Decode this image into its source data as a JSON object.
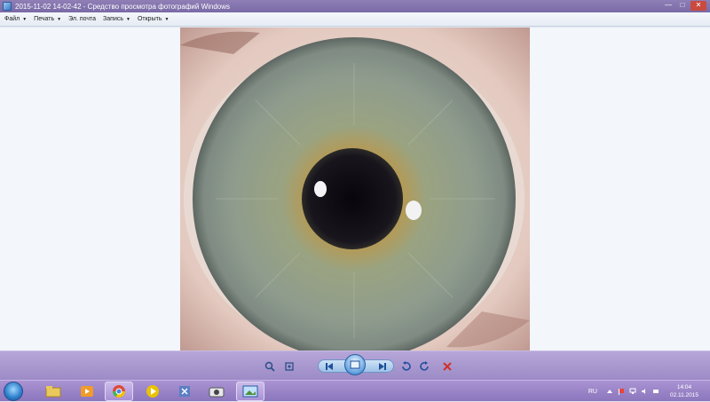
{
  "window": {
    "title": "2015-11-02 14-02-42 - Средство просмотра фотографий Windows",
    "controls": {
      "minimize": "—",
      "maximize": "□",
      "close": "✕"
    }
  },
  "menu": {
    "items": [
      {
        "label": "Файл"
      },
      {
        "label": "Печать"
      },
      {
        "label": "Эл. почта"
      },
      {
        "label": "Запись"
      },
      {
        "label": "Открыть"
      }
    ]
  },
  "viewer": {
    "image_subject": "close-up photo of a human eye iris",
    "colors": {
      "iris": "#8f9a80",
      "pupil": "#14121a",
      "sclera": "#e6d7cf",
      "background": "#f3f6fb"
    }
  },
  "toolbar": {
    "icons": [
      "zoom-icon",
      "actual-size-icon",
      "previous-icon",
      "slideshow-icon",
      "next-icon",
      "rotate-left-icon",
      "rotate-right-icon",
      "delete-icon"
    ]
  },
  "taskbar": {
    "apps": [
      "explorer-icon",
      "media-player-icon",
      "chrome-icon",
      "kmplayer-icon",
      "visual-studio-icon",
      "camera-icon",
      "photo-viewer-icon"
    ],
    "tray": {
      "language": "RU",
      "time": "14:04",
      "date": "02.11.2015"
    }
  }
}
